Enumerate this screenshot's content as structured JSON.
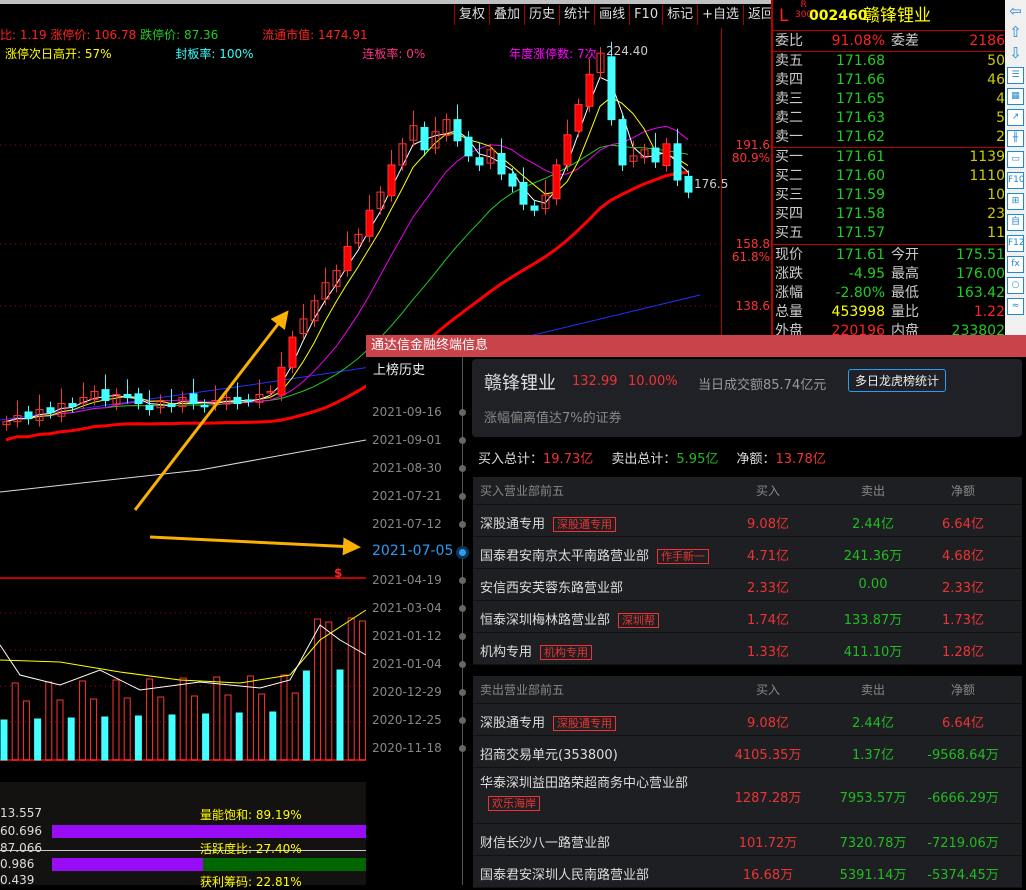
{
  "toolbar": [
    "复权",
    "叠加",
    "历史",
    "统计",
    "画线",
    "F10",
    "标记",
    "+自选",
    "返回"
  ],
  "info1": {
    "a": "比: 1.19",
    "b": "涨停价: 106.78",
    "c": "跌停价: 87.36",
    "d": "流通市值: 1474.91"
  },
  "info2": {
    "a": "涨停次日高开: 57%",
    "b": "封板率: 100%",
    "c": "连板率: 0%",
    "d": "年度涨停数: 7次"
  },
  "chart": {
    "peak_label": "224.40",
    "last_label": "176.5",
    "axis": [
      "191.6",
      "80.9%",
      "158.8",
      "61.8%",
      "138.6"
    ],
    "marker": "$",
    "closes": [
      100,
      102,
      101,
      104,
      103,
      106,
      105,
      108,
      110,
      107,
      109,
      108,
      106,
      104,
      107,
      105,
      108,
      106,
      105,
      107,
      108,
      106,
      107,
      109,
      110,
      118,
      128,
      134,
      140,
      146,
      150,
      158,
      162,
      170,
      176,
      185,
      192,
      198,
      190,
      196,
      200,
      193,
      188,
      185,
      190,
      182,
      178,
      172,
      170,
      175,
      185,
      195,
      205,
      215,
      222,
      200,
      185,
      188,
      190,
      186,
      192,
      180,
      176
    ]
  },
  "quote": {
    "flag": "L",
    "badge_top": "R",
    "badge_bot": "300",
    "code": "002460",
    "name": "赣锋锂业",
    "weibi_label": "委比",
    "weibi": "91.08%",
    "weicha_label": "委差",
    "weicha": "2186",
    "sells": [
      {
        "l": "卖五",
        "p": "171.68",
        "v": "50"
      },
      {
        "l": "卖四",
        "p": "171.66",
        "v": "46"
      },
      {
        "l": "卖三",
        "p": "171.65",
        "v": "4"
      },
      {
        "l": "卖二",
        "p": "171.63",
        "v": "5"
      },
      {
        "l": "卖一",
        "p": "171.62",
        "v": "2"
      }
    ],
    "buys": [
      {
        "l": "买一",
        "p": "171.61",
        "v": "1139"
      },
      {
        "l": "买二",
        "p": "171.60",
        "v": "1110"
      },
      {
        "l": "买三",
        "p": "171.59",
        "v": "10"
      },
      {
        "l": "买四",
        "p": "171.58",
        "v": "23"
      },
      {
        "l": "买五",
        "p": "171.57",
        "v": "11"
      }
    ],
    "stats": [
      {
        "l1": "现价",
        "v1": "171.61",
        "l2": "今开",
        "v2": "175.51"
      },
      {
        "l1": "涨跌",
        "v1": "-4.95",
        "l2": "最高",
        "v2": "176.00"
      },
      {
        "l1": "涨幅",
        "v1": "-2.80%",
        "l2": "最低",
        "v2": "163.42"
      },
      {
        "l1": "总量",
        "v1": "453998",
        "l2": "量比",
        "v2": "1.22"
      },
      {
        "l1": "外盘",
        "v1": "220196",
        "l2": "内盘",
        "v2": "233802"
      }
    ]
  },
  "sidebar_icons": [
    "arrow-left-icon",
    "arrow-up-icon",
    "arrow-down-icon",
    "list-check-icon",
    "grid-icon",
    "line-chart-icon",
    "candle-icon",
    "window-icon",
    "f10-icon",
    "tree-icon",
    "self-select-icon",
    "f12-icon",
    "fx-icon",
    "circle-icon",
    "wave-icon"
  ],
  "bottom": {
    "n1": "13.557",
    "n2": "60.696",
    "n3": "87.066",
    "n4": "0.986",
    "n5": "0.439",
    "t1": "量能饱和: 89.19%",
    "t2": "活跃度比: 27.40%",
    "t3": "获利筹码: 22.81%",
    "p1": 89.19,
    "p2": 27.4
  },
  "popup": {
    "title": "通达信金融终端信息",
    "history_title": "上榜历史",
    "dates": [
      "2021-09-16",
      "2021-09-01",
      "2021-08-30",
      "2021-07-21",
      "2021-07-12",
      "2021-07-05",
      "2021-04-19",
      "2021-03-04",
      "2021-01-12",
      "2021-01-04",
      "2020-12-29",
      "2020-12-25",
      "2020-11-18"
    ],
    "selected_index": 5,
    "stock_name": "赣锋锂业",
    "price": "132.99",
    "pct": "10.00%",
    "amount": "当日成交额85.74亿元",
    "multi_day_button": "多日龙虎榜统计",
    "reason": "涨幅偏离值达7%的证券",
    "totals": {
      "buy_label": "买入总计：",
      "buy": "19.73亿",
      "sell_label": "卖出总计：",
      "sell": "5.95亿",
      "net_label": "净额：",
      "net": "13.78亿"
    },
    "buy_table": {
      "headers": [
        "买入营业部前五",
        "买入",
        "卖出",
        "净额"
      ],
      "rows": [
        {
          "name": "深股通专用",
          "tag": "深股通专用",
          "buy": "9.08亿",
          "sell": "2.44亿",
          "net": "6.64亿"
        },
        {
          "name": "国泰君安南京太平南路营业部",
          "tag": "作手新一",
          "buy": "4.71亿",
          "sell": "241.36万",
          "net": "4.68亿"
        },
        {
          "name": "安信西安芙蓉东路营业部",
          "tag": "",
          "buy": "2.33亿",
          "sell": "0.00",
          "net": "2.33亿"
        },
        {
          "name": "恒泰深圳梅林路营业部",
          "tag": "深圳帮",
          "buy": "1.74亿",
          "sell": "133.87万",
          "net": "1.73亿"
        },
        {
          "name": "机构专用",
          "tag": "机构专用",
          "buy": "1.33亿",
          "sell": "411.10万",
          "net": "1.28亿"
        }
      ]
    },
    "sell_table": {
      "headers": [
        "卖出营业部前五",
        "买入",
        "卖出",
        "净额"
      ],
      "rows": [
        {
          "name": "深股通专用",
          "tag": "深股通专用",
          "buy": "9.08亿",
          "sell": "2.44亿",
          "net": "6.64亿"
        },
        {
          "name": "招商交易单元(353800)",
          "tag": "",
          "buy": "4105.35万",
          "sell": "1.37亿",
          "net": "-9568.64万"
        },
        {
          "name": "华泰深圳益田路荣超商务中心营业部",
          "tag": "欢乐海岸",
          "buy": "1287.28万",
          "sell": "7953.57万",
          "net": "-6666.29万"
        },
        {
          "name": "财信长沙八一路营业部",
          "tag": "",
          "buy": "101.72万",
          "sell": "7320.78万",
          "net": "-7219.06万"
        },
        {
          "name": "国泰君安深圳人民南路营业部",
          "tag": "",
          "buy": "16.68万",
          "sell": "5391.14万",
          "net": "-5374.45万"
        }
      ]
    }
  }
}
